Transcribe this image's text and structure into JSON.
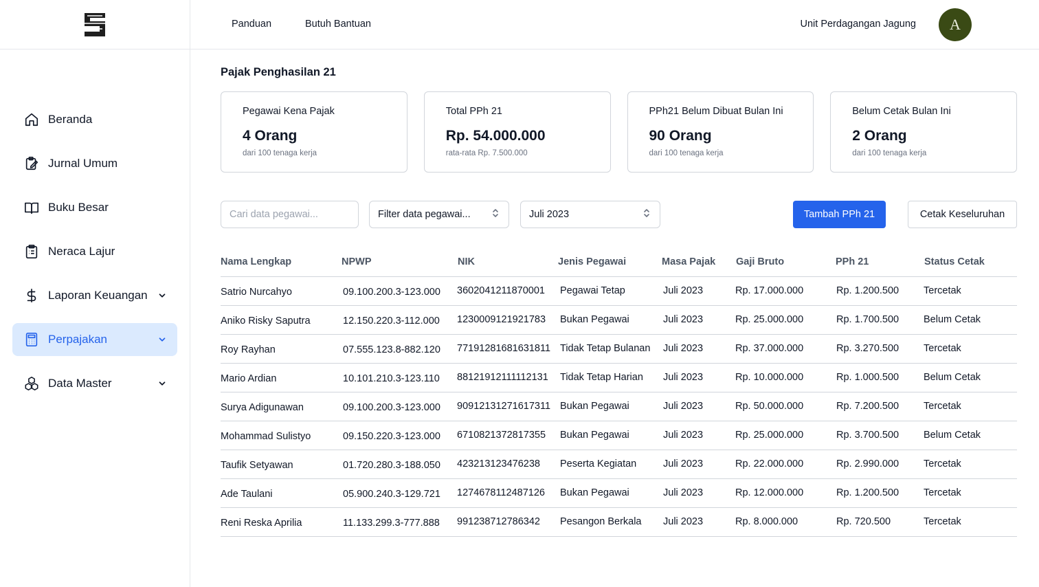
{
  "sidebar": {
    "logo_icon": "company-logo",
    "items": [
      {
        "label": "Beranda",
        "icon": "home-icon"
      },
      {
        "label": "Jurnal Umum",
        "icon": "clipboard-edit-icon"
      },
      {
        "label": "Buku Besar",
        "icon": "book-open-icon"
      },
      {
        "label": "Neraca Lajur",
        "icon": "clipboard-list-icon"
      },
      {
        "label": "Laporan Keuangan",
        "icon": "dollar-icon",
        "expandable": true
      },
      {
        "label": "Perpajakan",
        "icon": "calculator-icon",
        "expandable": true,
        "active": true
      },
      {
        "label": "Data Master",
        "icon": "cubes-icon",
        "expandable": true
      }
    ]
  },
  "topbar": {
    "links": [
      "Panduan",
      "Butuh Bantuan"
    ],
    "unit_name": "Unit Perdagangan Jagung",
    "avatar_letter": "A"
  },
  "page": {
    "title": "Pajak Penghasilan 21"
  },
  "cards": [
    {
      "title": "Pegawai Kena Pajak",
      "value": "4 Orang",
      "sub": "dari 100 tenaga kerja"
    },
    {
      "title": "Total PPh 21",
      "value": "Rp. 54.000.000",
      "sub": "rata-rata Rp. 7.500.000"
    },
    {
      "title": "PPh21 Belum Dibuat Bulan Ini",
      "value": "90 Orang",
      "sub": "dari 100 tenaga kerja"
    },
    {
      "title": "Belum Cetak Bulan Ini",
      "value": "2 Orang",
      "sub": "dari 100 tenaga kerja"
    }
  ],
  "controls": {
    "search_placeholder": "Cari data pegawai...",
    "filter_value": "Filter data pegawai...",
    "period_value": "Juli 2023",
    "add_button": "Tambah PPh 21",
    "print_button": "Cetak Keseluruhan"
  },
  "table": {
    "headers": [
      "Nama Lengkap",
      "NPWP",
      "NIK",
      "Jenis Pegawai",
      "Masa Pajak",
      "Gaji Bruto",
      "PPh 21",
      "Status Cetak"
    ],
    "rows": [
      [
        "Satrio Nurcahyo",
        "09.100.200.3-123.000",
        "3602041211870001",
        "Pegawai Tetap",
        "Juli 2023",
        "Rp. 17.000.000",
        "Rp. 1.200.500",
        "Tercetak"
      ],
      [
        "Aniko Risky Saputra",
        "12.150.220.3-112.000",
        "1230009121921783",
        "Bukan Pegawai",
        "Juli 2023",
        "Rp. 25.000.000",
        "Rp. 1.700.500",
        "Belum Cetak"
      ],
      [
        "Roy Rayhan",
        "07.555.123.8-882.120",
        "77191281681631811",
        "Tidak Tetap Bulanan",
        "Juli 2023",
        "Rp. 37.000.000",
        "Rp. 3.270.500",
        "Tercetak"
      ],
      [
        "Mario Ardian",
        "10.101.210.3-123.110",
        "88121912111112131",
        "Tidak Tetap Harian",
        "Juli 2023",
        "Rp. 10.000.000",
        "Rp. 1.000.500",
        "Belum Cetak"
      ],
      [
        "Surya Adigunawan",
        "09.100.200.3-123.000",
        "90912131271617311",
        "Bukan Pegawai",
        "Juli 2023",
        "Rp. 50.000.000",
        "Rp. 7.200.500",
        "Tercetak"
      ],
      [
        "Mohammad Sulistyo",
        "09.150.220.3-123.000",
        "6710821372817355",
        "Bukan Pegawai",
        "Juli 2023",
        "Rp. 25.000.000",
        "Rp. 3.700.500",
        "Belum Cetak"
      ],
      [
        "Taufik Setyawan",
        "01.720.280.3-188.050",
        "423213123476238",
        "Peserta Kegiatan",
        "Juli 2023",
        "Rp. 22.000.000",
        "Rp. 2.990.000",
        "Tercetak"
      ],
      [
        "Ade Taulani",
        "05.900.240.3-129.721",
        "1274678112487126",
        "Bukan Pegawai",
        "Juli 2023",
        "Rp. 12.000.000",
        "Rp. 1.200.500",
        "Tercetak"
      ],
      [
        "Reni Reska Aprilia",
        "11.133.299.3-777.888",
        "991238712786342",
        "Pesangon Berkala",
        "Juli 2023",
        "Rp. 8.000.000",
        "Rp. 720.500",
        "Tercetak"
      ]
    ]
  },
  "colors": {
    "accent": "#2563eb",
    "active_bg": "#dbeafe",
    "avatar_bg": "#3a4a15",
    "border": "#d1d5db"
  }
}
